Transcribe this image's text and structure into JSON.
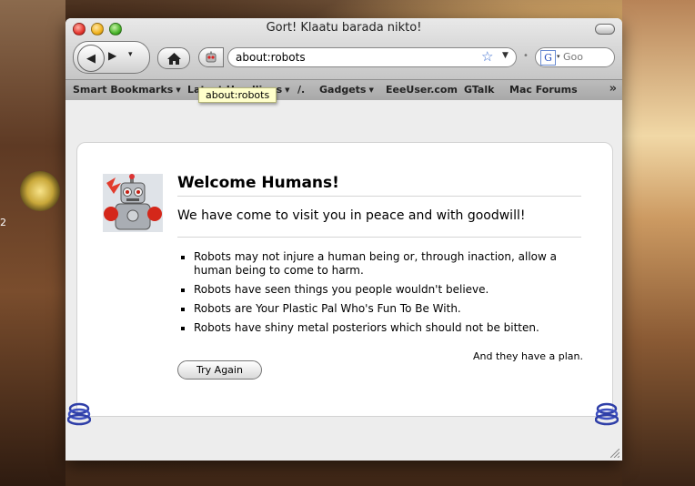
{
  "desktop": {
    "number_fragment": "2"
  },
  "window": {
    "title": "Gort! Klaatu barada nikto!"
  },
  "toolbar": {
    "url": "about:robots",
    "search_placeholder": "Goo"
  },
  "bookmarks": {
    "items": [
      {
        "label": "Smart Bookmarks",
        "dropdown": true
      },
      {
        "label": "Latest Headlines",
        "dropdown": true
      },
      {
        "label": "/.",
        "dropdown": false
      },
      {
        "label": "Gadgets",
        "dropdown": true
      },
      {
        "label": "EeeUser.com",
        "dropdown": false
      },
      {
        "label": "GTalk",
        "dropdown": false
      },
      {
        "label": "Mac Forums",
        "dropdown": false
      }
    ],
    "more": "»"
  },
  "tooltip": {
    "text": "about:robots"
  },
  "page": {
    "heading": "Welcome Humans!",
    "subheading": "We have come to visit you in peace and with goodwill!",
    "laws": [
      "Robots may not injure a human being or, through inaction, allow a human being to come to harm.",
      "Robots have seen things you people wouldn't believe.",
      "Robots are Your Plastic Pal Who's Fun To Be With.",
      "Robots have shiny metal posteriors which should not be bitten."
    ],
    "plan": "And they have a plan.",
    "try_again": "Try Again"
  },
  "icons": {
    "window_controls": [
      "close-icon",
      "minimize-icon",
      "zoom-icon"
    ],
    "toolbar": [
      "back-arrow-icon",
      "forward-arrow-icon",
      "home-icon",
      "robot-favicon",
      "bookmark-star-icon",
      "google-icon"
    ]
  },
  "colors": {
    "star": "#3d6ed0",
    "tooltip_bg": "#ffffcb"
  }
}
